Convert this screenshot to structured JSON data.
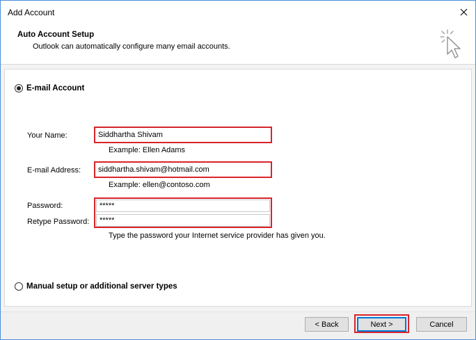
{
  "window": {
    "title": "Add Account"
  },
  "header": {
    "title": "Auto Account Setup",
    "subtitle": "Outlook can automatically configure many email accounts."
  },
  "options": {
    "email_account": {
      "label": "E-mail Account",
      "selected": true
    },
    "manual_setup": {
      "label": "Manual setup or additional server types",
      "selected": false
    }
  },
  "form": {
    "name": {
      "label": "Your Name:",
      "value": "Siddhartha Shivam",
      "example": "Example: Ellen Adams"
    },
    "email": {
      "label": "E-mail Address:",
      "value": "siddhartha.shivam@hotmail.com",
      "example": "Example: ellen@contoso.com"
    },
    "password": {
      "label": "Password:",
      "value": "*****"
    },
    "retype_password": {
      "label": "Retype Password:",
      "value": "*****"
    },
    "password_hint": "Type the password your Internet service provider has given you."
  },
  "buttons": {
    "back": "< Back",
    "next": "Next >",
    "cancel": "Cancel"
  },
  "colors": {
    "highlight": "#d9232b",
    "focus": "#0078d7"
  }
}
